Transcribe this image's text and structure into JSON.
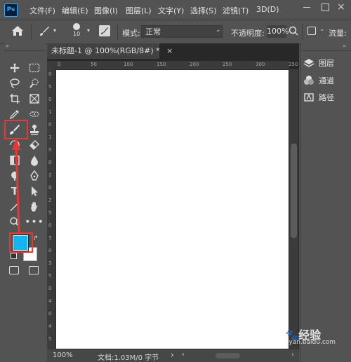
{
  "app": {
    "logo": "Ps"
  },
  "menu": [
    "文件(F)",
    "编辑(E)",
    "图像(I)",
    "图层(L)",
    "文字(Y)",
    "选择(S)",
    "滤镜(T)",
    "3D(D)"
  ],
  "options": {
    "brush_size": "10",
    "mode_label": "模式:",
    "mode_value": "正常",
    "opacity_label": "不透明度:",
    "opacity_value": "100%",
    "flow_label": "流量:"
  },
  "document": {
    "tab_title": "未标题-1 @ 100%(RGB/8#) *",
    "close_glyph": "×",
    "ruler_top": [
      "0",
      "50",
      "100",
      "150",
      "200",
      "250",
      "300",
      "350"
    ],
    "ruler_left": [
      "0",
      "5",
      "0",
      "1",
      "0",
      "1",
      "5",
      "0",
      "2",
      "0",
      "2",
      "5",
      "0",
      "3",
      "0",
      "3",
      "5",
      "0",
      "4",
      "0",
      "4",
      "5"
    ]
  },
  "status": {
    "zoom": "100%",
    "doc_info": "文档:1.03M/0 字节",
    "arrow": "›"
  },
  "panels": [
    {
      "label": "图层",
      "icon": "layers-icon"
    },
    {
      "label": "通道",
      "icon": "channels-icon"
    },
    {
      "label": "路径",
      "icon": "paths-icon"
    }
  ],
  "colors": {
    "foreground": "#14b4f0",
    "background": "#ffffff",
    "highlight": "#e53935"
  },
  "watermark": {
    "brand": "Bai",
    "brand2": "经验",
    "url": "jingyan.baidu.com"
  }
}
